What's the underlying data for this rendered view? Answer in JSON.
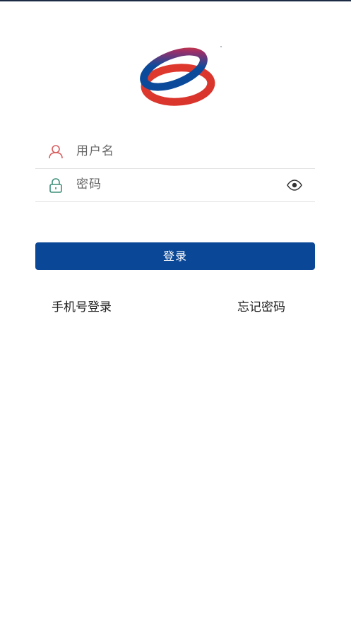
{
  "logo": {
    "icon": "brand-ring-logo-icon",
    "colors": [
      "#0b4a9b",
      "#e03a2e"
    ]
  },
  "username": {
    "placeholder": "用户名",
    "icon": "user-icon",
    "icon_color": "#d85c5c"
  },
  "password": {
    "placeholder": "密码",
    "icon": "lock-icon",
    "icon_color": "#3f8f7a",
    "toggle_icon": "eye-icon"
  },
  "login_button": {
    "label": "登录",
    "color": "#0a4796"
  },
  "links": {
    "phone_login": "手机号登录",
    "forgot_password": "忘记密码"
  }
}
